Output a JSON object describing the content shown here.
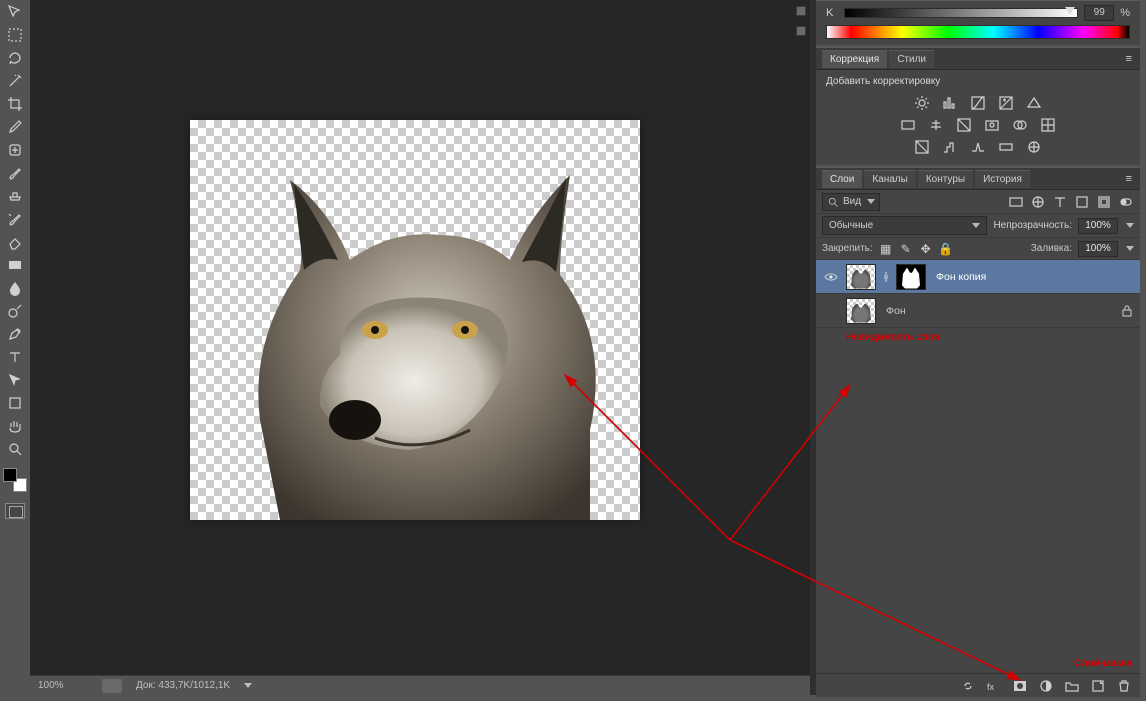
{
  "toolstrip": {
    "tools": [
      "move",
      "marquee",
      "lasso",
      "magic-wand",
      "crop",
      "eyedropper",
      "healing-brush",
      "brush",
      "clone-stamp",
      "history-brush",
      "eraser",
      "gradient",
      "blur",
      "dodge",
      "pen",
      "type",
      "path-select",
      "shape",
      "hand",
      "zoom"
    ]
  },
  "statusbar": {
    "zoom": "100%",
    "doc_info": "Док: 433,7K/1012,1K"
  },
  "color_panel": {
    "channel_label": "K",
    "value": "99",
    "pct": "%"
  },
  "adjustments": {
    "tab_adjust": "Коррекция",
    "tab_styles": "Стили",
    "help": "Добавить корректировку"
  },
  "layers": {
    "tab_layers": "Слои",
    "tab_channels": "Каналы",
    "tab_contours": "Контуры",
    "tab_history": "История",
    "filter_label": "Вид",
    "blend_mode": "Обычные",
    "opacity_label": "Непрозрачность:",
    "opacity_value": "100%",
    "lock_label": "Закрепить:",
    "fill_label": "Заливка:",
    "fill_value": "100%",
    "rows": [
      {
        "visible": true,
        "name": "Фон копия",
        "has_mask": true,
        "locked": false,
        "selected": true
      },
      {
        "visible": false,
        "name": "Фон",
        "has_mask": false,
        "locked": true,
        "selected": false
      }
    ]
  },
  "annotations": {
    "invisibility": "Невидимость слоя",
    "layer_mask": "Слой-маска"
  }
}
